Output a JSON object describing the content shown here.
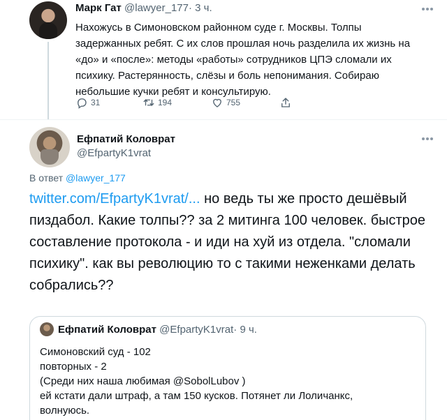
{
  "tweet1": {
    "name": "Марк Гат",
    "handle": "@lawyer_177",
    "time": "· 3 ч.",
    "body": "Нахожусь в Симоновском районном суде г. Москвы. Толпы задержанных ребят. С их слов прошлая ночь разделила их жизнь на «до» и «после»: методы «работы» сотрудников ЦПЭ сломали их психику. Растерянность, слёзы и боль непонимания. Собираю небольшие кучки ребят и консультирую.",
    "replies": "31",
    "retweets": "194",
    "likes": "755"
  },
  "tweet2": {
    "name": "Ефпатий Коловрат",
    "handle": "@EfpartyK1vrat",
    "reply_prefix": "В ответ",
    "reply_handle": "@lawyer_177",
    "link": "twitter.com/EfpartyK1vrat/...",
    "body": " но ведь ты же просто дешёвый пиздабол. Какие толпы?? за 2 митинга 100 человек. быстрое составление протокола - и иди на хуй из отдела. \"сломали психику\". как вы революцию то с такими неженками делать собрались??"
  },
  "quote": {
    "name": "Ефпатий Коловрат",
    "handle": "@EfpartyK1vrat",
    "time": "· 9 ч.",
    "lines": [
      "Симоновский суд - 102",
      "повторных - 2",
      "(Среди них наша любимая @SobolLubov )",
      "ей кстати дали штраф, а там 150 кусков. Потянет ли Лоличанкс,",
      "волнуюсь."
    ]
  },
  "icons": [
    "more-icon",
    "reply-icon",
    "retweet-icon",
    "like-icon",
    "share-icon"
  ],
  "colors": {
    "link": "#1d9bf0",
    "muted": "#536471",
    "text": "#0f1419",
    "border": "#cfd9de"
  }
}
